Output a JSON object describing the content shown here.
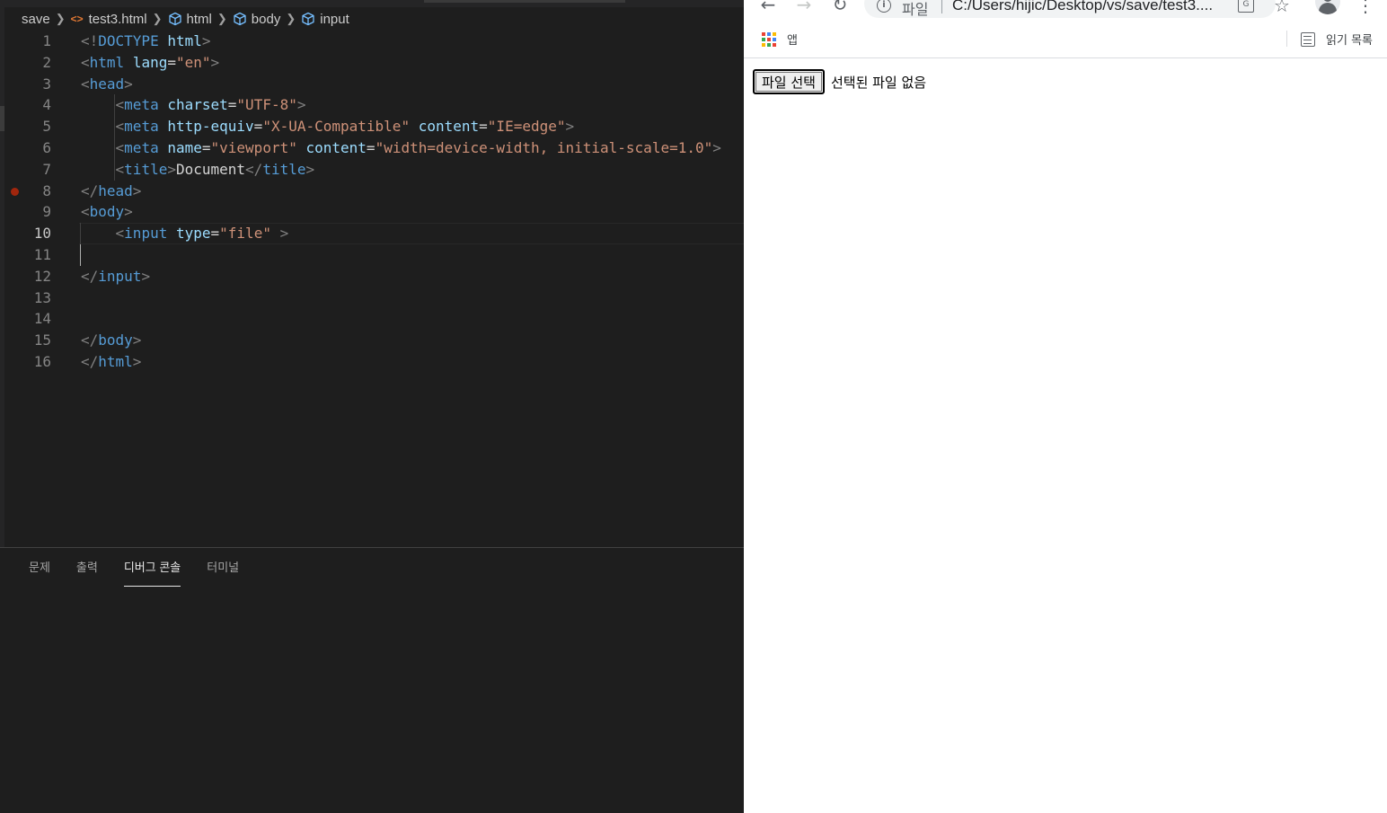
{
  "breadcrumb": {
    "folder": "save",
    "file": "test3.html",
    "items": [
      "html",
      "body",
      "input"
    ]
  },
  "editor": {
    "lines": [
      {
        "n": "1",
        "tokens": [
          [
            "p",
            "<!"
          ],
          [
            "t",
            "DOCTYPE"
          ],
          [
            "x",
            " "
          ],
          [
            "a",
            "html"
          ],
          [
            "p",
            ">"
          ]
        ]
      },
      {
        "n": "2",
        "tokens": [
          [
            "p",
            "<"
          ],
          [
            "t",
            "html"
          ],
          [
            "x",
            " "
          ],
          [
            "a",
            "lang"
          ],
          [
            "x",
            "="
          ],
          [
            "s",
            "\"en\""
          ],
          [
            "p",
            ">"
          ]
        ]
      },
      {
        "n": "3",
        "tokens": [
          [
            "p",
            "<"
          ],
          [
            "t",
            "head"
          ],
          [
            "p",
            ">"
          ]
        ]
      },
      {
        "n": "4",
        "tokens": [
          [
            "x",
            "    "
          ],
          [
            "p",
            "<"
          ],
          [
            "t",
            "meta"
          ],
          [
            "x",
            " "
          ],
          [
            "a",
            "charset"
          ],
          [
            "x",
            "="
          ],
          [
            "s",
            "\"UTF-8\""
          ],
          [
            "p",
            ">"
          ]
        ]
      },
      {
        "n": "5",
        "tokens": [
          [
            "x",
            "    "
          ],
          [
            "p",
            "<"
          ],
          [
            "t",
            "meta"
          ],
          [
            "x",
            " "
          ],
          [
            "a",
            "http-equiv"
          ],
          [
            "x",
            "="
          ],
          [
            "s",
            "\"X-UA-Compatible\""
          ],
          [
            "x",
            " "
          ],
          [
            "a",
            "content"
          ],
          [
            "x",
            "="
          ],
          [
            "s",
            "\"IE=edge\""
          ],
          [
            "p",
            ">"
          ]
        ]
      },
      {
        "n": "6",
        "tokens": [
          [
            "x",
            "    "
          ],
          [
            "p",
            "<"
          ],
          [
            "t",
            "meta"
          ],
          [
            "x",
            " "
          ],
          [
            "a",
            "name"
          ],
          [
            "x",
            "="
          ],
          [
            "s",
            "\"viewport\""
          ],
          [
            "x",
            " "
          ],
          [
            "a",
            "content"
          ],
          [
            "x",
            "="
          ],
          [
            "s",
            "\"width=device-width, initial-scale=1.0\""
          ],
          [
            "p",
            ">"
          ]
        ]
      },
      {
        "n": "7",
        "tokens": [
          [
            "x",
            "    "
          ],
          [
            "p",
            "<"
          ],
          [
            "t",
            "title"
          ],
          [
            "p",
            ">"
          ],
          [
            "x",
            "Document"
          ],
          [
            "p",
            "</"
          ],
          [
            "t",
            "title"
          ],
          [
            "p",
            ">"
          ]
        ]
      },
      {
        "n": "8",
        "tokens": [
          [
            "p",
            "</"
          ],
          [
            "t",
            "head"
          ],
          [
            "p",
            ">"
          ]
        ]
      },
      {
        "n": "9",
        "tokens": [
          [
            "p",
            "<"
          ],
          [
            "t",
            "body"
          ],
          [
            "p",
            ">"
          ]
        ]
      },
      {
        "n": "10",
        "tokens": [
          [
            "x",
            "    "
          ],
          [
            "p",
            "<"
          ],
          [
            "t",
            "input"
          ],
          [
            "x",
            " "
          ],
          [
            "a",
            "type"
          ],
          [
            "x",
            "="
          ],
          [
            "s",
            "\"file\""
          ],
          [
            "x",
            " "
          ],
          [
            "p",
            ">"
          ]
        ]
      },
      {
        "n": "11",
        "tokens": []
      },
      {
        "n": "12",
        "tokens": [
          [
            "p",
            "</"
          ],
          [
            "t",
            "input"
          ],
          [
            "p",
            ">"
          ]
        ]
      },
      {
        "n": "13",
        "tokens": []
      },
      {
        "n": "14",
        "tokens": []
      },
      {
        "n": "15",
        "tokens": [
          [
            "p",
            "</"
          ],
          [
            "t",
            "body"
          ],
          [
            "p",
            ">"
          ]
        ]
      },
      {
        "n": "16",
        "tokens": [
          [
            "p",
            "</"
          ],
          [
            "t",
            "html"
          ],
          [
            "p",
            ">"
          ]
        ]
      }
    ],
    "active_line": "10",
    "breakpoint_line": "8"
  },
  "panel": {
    "tabs": [
      "문제",
      "출력",
      "디버그 콘솔",
      "터미널"
    ],
    "active_tab": "디버그 콘솔"
  },
  "browser": {
    "scheme_label": "파일",
    "url": "C:/Users/hijic/Desktop/vs/save/test3....",
    "bookmarks": {
      "apps_label": "앱",
      "reading_list_label": "읽기 목록"
    },
    "page": {
      "file_button_label": "파일 선택",
      "file_status": "선택된 파일 없음"
    }
  },
  "colors": {
    "editor_bg": "#1e1e1e",
    "tag": "#569cd6",
    "attribute": "#9cdcfe",
    "string": "#ce9178",
    "punctuation": "#808080",
    "breakpoint": "#a1260d"
  },
  "icons": {
    "file_icon": "html-file-icon",
    "breadcrumb_symbol": "cube-icon",
    "back": "arrow-left-icon",
    "forward": "arrow-right-icon",
    "reload": "reload-icon",
    "info": "info-icon",
    "translate": "translate-icon",
    "bookmark_star": "star-icon",
    "profile": "avatar-icon",
    "menu": "kebab-menu-icon",
    "apps": "apps-grid-icon",
    "reading_list": "reading-list-icon"
  }
}
